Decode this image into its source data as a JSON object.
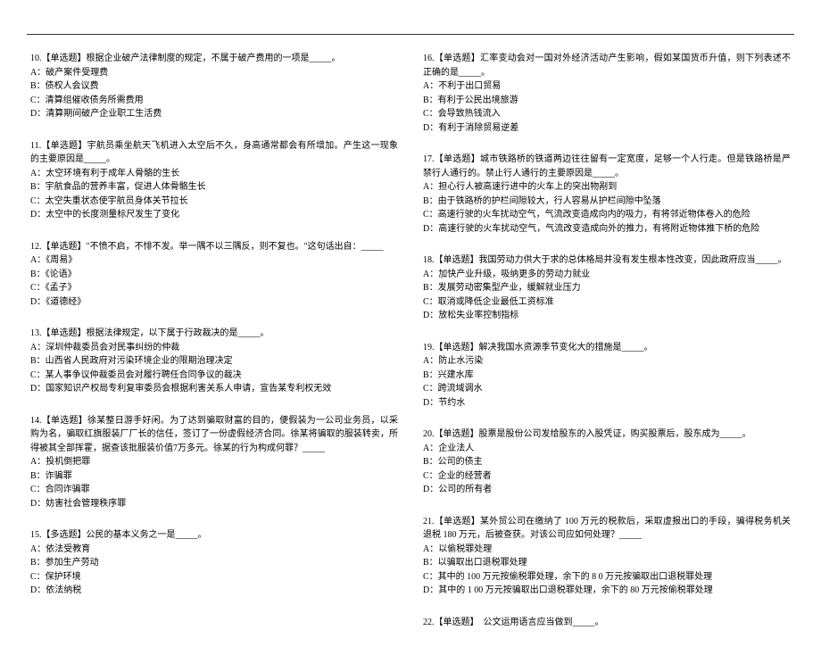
{
  "left": {
    "q10": {
      "stem": "10.【单选题】根据企业破产法律制度的规定，不属于破产费用的一项是_____。",
      "A": "A：破产案件受理费",
      "B": "B：债权人会议费",
      "C": "C：清算组催收债务所需费用",
      "D": "D：清算期间破产企业职工生活费"
    },
    "q11": {
      "stem": "11.【单选题】宇航员乘坐航天飞机进入太空后不久，身高通常都会有所增加。产生这一现象的主要原因是_____。",
      "A": "A：太空环境有利于成年人骨骼的生长",
      "B": "B：宇航食品的营养丰富，促进人体骨骼生长",
      "C": "C：太空失重状态使宇航员身体关节拉长",
      "D": "D：太空中的长度测量标尺发生了变化"
    },
    "q12": {
      "stem": "12.【单选题】\"不愤不启，不悱不发。举一隅不以三隅反，则不复也。\"这句话出自：_____",
      "A": "A：《周易》",
      "B": "B：《论语》",
      "C": "C：《孟子》",
      "D": "D：《道德经》"
    },
    "q13": {
      "stem": "13.【单选题】根据法律规定，以下属于行政裁决的是_____。",
      "A": "A：深圳仲裁委员会对民事纠纷的仲裁",
      "B": "B：山西省人民政府对污染环境企业的限期治理决定",
      "C": "C：某人事争议仲裁委员会对履行聘任合同争议的裁决",
      "D": "D：国家知识产权局专利复审委员会根据利害关系人申请，宣告某专利权无效"
    },
    "q14": {
      "stem": "14.【单选题】徐某整日游手好闲。为了达到骗取财富的目的，便假装为一公司业务员，以采购为名，骗取红旗服装厂厂长的信任，签订了一份虚假经济合同。徐某将骗取的服装转卖，所得被其全部挥霍，据查该批服装价值7万多元。徐某的行为构成何罪？_____",
      "A": "A：投机倒把罪",
      "B": "B：诈骗罪",
      "C": "C：合同诈骗罪",
      "D": "D：妨害社会管理秩序罪"
    },
    "q15": {
      "stem": "15.【多选题】公民的基本义务之一是_____。",
      "A": "A：依法受教育",
      "B": "B：参加生产劳动",
      "C": "C：保护环境",
      "D": "D：依法纳税"
    }
  },
  "right": {
    "q16": {
      "stem": "16.【单选题】汇率变动会对一国对外经济活动产生影响，假如某国货币升值，则下列表述不正确的是_____。",
      "A": "A：不利于出口贸易",
      "B": "B：有利于公民出境旅游",
      "C": "C：会导致热钱流入",
      "D": "D：有利于消除贸易逆差"
    },
    "q17": {
      "stem": "17.【单选题】城市铁路桥的铁道两边往往留有一定宽度，足够一个人行走。但是铁路桥是严禁行人通行的。禁止行人通行的主要原因是_____。",
      "A": "A：担心行人被高速行进中的火车上的突出物剐到",
      "B": "B：由于铁路桥的护栏间隙较大，行人容易从护栏间隙中坠落",
      "C": "C：高速行驶的火车扰动空气，气流改变造成向内的吸力，有将邻近物体卷入的危险",
      "D": "D：高速行驶的火车扰动空气，气流改变造成向外的推力，有将附近物体推下桥的危险"
    },
    "q18": {
      "stem": "18.【单选题】我国劳动力供大于求的总体格局并没有发生根本性改变，因此政府应当_____。",
      "A": "A：加快产业升级，吸纳更多的劳动力就业",
      "B": "B：发展劳动密集型产业，缓解就业压力",
      "C": "C：取消或降低企业最低工资标准",
      "D": "D：放松失业率控制指标"
    },
    "q19": {
      "stem": "19.【单选题】解决我国水资源季节变化大的措施是_____。",
      "A": "A：防止水污染",
      "B": "B：兴建水库",
      "C": "C：跨流域调水",
      "D": "D：节约水"
    },
    "q20": {
      "stem": "20.【单选题】股票是股份公司发给股东的入股凭证，购买股票后，股东成为_____。",
      "A": "A：企业法人",
      "B": "B：公司的债主",
      "C": "C：企业的经营者",
      "D": "D：公司的所有者"
    },
    "q21": {
      "stem": "21.【单选题】某外贸公司在缴纳了 100 万元的税款后，采取虚报出口的手段，骗得税务机关退税 180 万元，后被查获。对该公司应如何处理？_____",
      "A": "A：以偷税罪处理",
      "B": "B：以骗取出口退税罪处理",
      "C": "C：其中的 100 万元按偷税罪处理，余下的 8 0 万元按骗取出口退税罪处理",
      "D": "D：其中的 1 00 万元按骗取出口退税罪处理，余下的 80 万元按偷税罪处理"
    },
    "q22": {
      "stem": "22.【单选题】　公文运用语言应当做到_____。"
    }
  }
}
